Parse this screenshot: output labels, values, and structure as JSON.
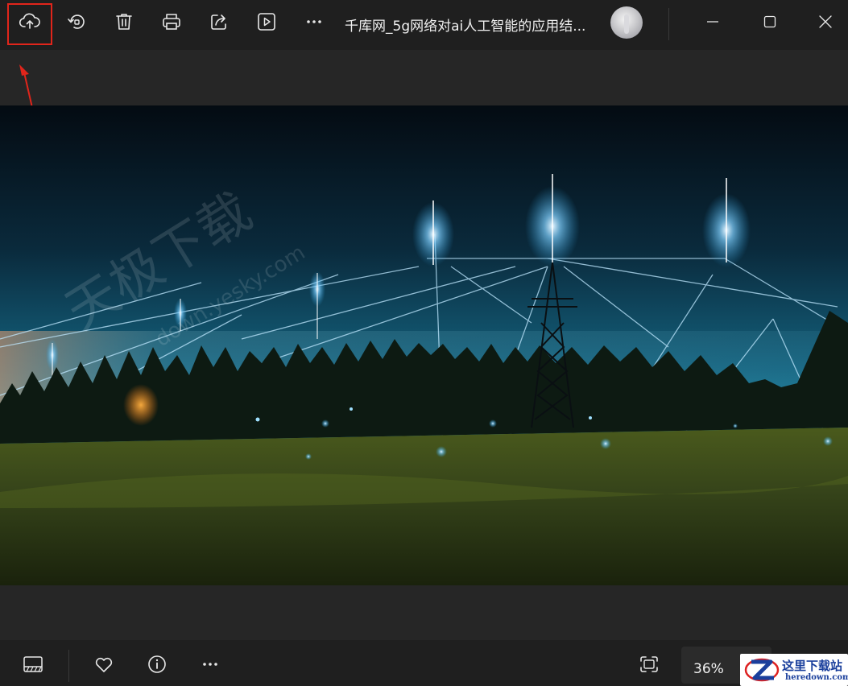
{
  "topbar": {
    "title": "千库网_5g网络对ai人工智能的应用结...",
    "icons": [
      "upload-cloud-icon",
      "rotate-icon",
      "delete-icon",
      "print-icon",
      "share-icon",
      "slideshow-icon",
      "more-icon"
    ]
  },
  "annotation": {
    "highlight_color": "#e1251b",
    "target": "upload-cloud-icon"
  },
  "photo": {
    "watermark_cn": "天极下载",
    "watermark_en": "down.yesky.com"
  },
  "bottombar": {
    "zoom": "36%",
    "icons": [
      "filmstrip-icon",
      "heart-icon",
      "info-icon",
      "more-icon",
      "fit-to-window-icon"
    ]
  },
  "site_watermark": {
    "cn": "这里下载站",
    "en": "heredown.com"
  },
  "colors": {
    "toolbar_bg": "#1f1f1f",
    "canvas_bg": "#262626",
    "accent_red": "#e1251b",
    "logo_blue": "#1a3f9c"
  }
}
